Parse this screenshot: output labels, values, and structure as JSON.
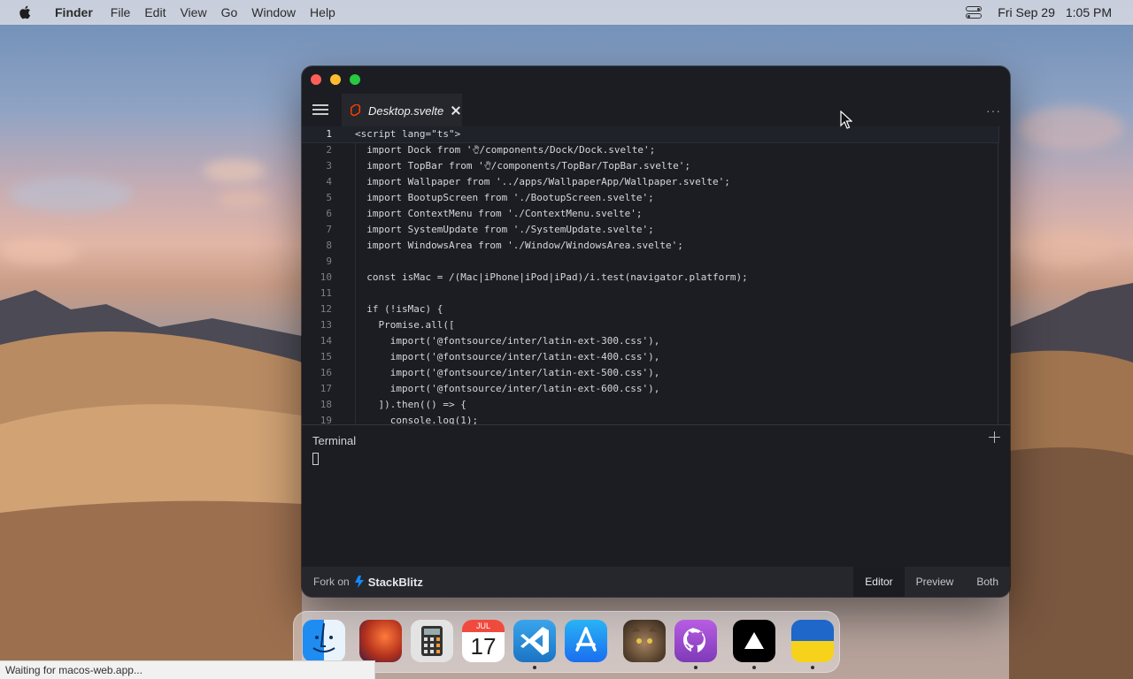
{
  "menubar": {
    "apple_icon": "apple-logo-icon",
    "app_name": "Finder",
    "items": [
      "File",
      "Edit",
      "View",
      "Go",
      "Window",
      "Help"
    ],
    "control_center_icon": "control-center-icon",
    "date": "Fri Sep 29",
    "time": "1:05 PM"
  },
  "window": {
    "tab": {
      "icon": "svelte-icon",
      "label": "Desktop.svelte"
    },
    "more_icon": "more-icon",
    "editor": {
      "current_line": 1,
      "lines": [
        {
          "num": "1",
          "text": "<script lang=\"ts\">"
        },
        {
          "num": "2",
          "text": "  import Dock from '🖐︎/components/Dock/Dock.svelte';"
        },
        {
          "num": "3",
          "text": "  import TopBar from '🖐︎/components/TopBar/TopBar.svelte';"
        },
        {
          "num": "4",
          "text": "  import Wallpaper from '../apps/WallpaperApp/Wallpaper.svelte';"
        },
        {
          "num": "5",
          "text": "  import BootupScreen from './BootupScreen.svelte';"
        },
        {
          "num": "6",
          "text": "  import ContextMenu from './ContextMenu.svelte';"
        },
        {
          "num": "7",
          "text": "  import SystemUpdate from './SystemUpdate.svelte';"
        },
        {
          "num": "8",
          "text": "  import WindowsArea from './Window/WindowsArea.svelte';"
        },
        {
          "num": "9",
          "text": ""
        },
        {
          "num": "10",
          "text": "  const isMac = /(Mac|iPhone|iPod|iPad)/i.test(navigator.platform);"
        },
        {
          "num": "11",
          "text": ""
        },
        {
          "num": "12",
          "text": "  if (!isMac) {"
        },
        {
          "num": "13",
          "text": "    Promise.all(["
        },
        {
          "num": "14",
          "text": "      import('@fontsource/inter/latin-ext-300.css'),"
        },
        {
          "num": "15",
          "text": "      import('@fontsource/inter/latin-ext-400.css'),"
        },
        {
          "num": "16",
          "text": "      import('@fontsource/inter/latin-ext-500.css'),"
        },
        {
          "num": "17",
          "text": "      import('@fontsource/inter/latin-ext-600.css'),"
        },
        {
          "num": "18",
          "text": "    ]).then(() => {"
        },
        {
          "num": "19",
          "text": "      console.log(1);"
        }
      ]
    },
    "terminal": {
      "title": "Terminal",
      "add_icon": "plus-icon"
    },
    "footer": {
      "fork_text": "Fork on",
      "brand_icon": "bolt-icon",
      "brand": "StackBlitz",
      "views": [
        "Editor",
        "Preview",
        "Both"
      ],
      "active_view": "Editor"
    }
  },
  "dock": {
    "apps": [
      {
        "name": "Finder",
        "icon": "finder-icon",
        "running": false
      },
      {
        "name": "Wallpapers",
        "icon": "wallpapers-icon",
        "running": false
      },
      {
        "name": "Calculator",
        "icon": "calculator-icon",
        "running": false
      },
      {
        "name": "Calendar",
        "icon": "calendar-icon",
        "month": "JUL",
        "day": "17",
        "running": false
      },
      {
        "name": "VS Code",
        "icon": "vscode-icon",
        "running": true
      },
      {
        "name": "App Store",
        "icon": "app-store-icon",
        "running": false
      },
      {
        "name": "Purrfect",
        "icon": "cat-icon",
        "running": false
      },
      {
        "name": "GitHub",
        "icon": "github-icon",
        "running": true
      },
      {
        "name": "Vercel",
        "icon": "vercel-icon",
        "running": true
      },
      {
        "name": "Ukraine",
        "icon": "ukraine-flag-icon",
        "running": true
      }
    ]
  },
  "status": {
    "text": "Waiting for macos-web.app..."
  },
  "colors": {
    "accent_svelte": "#ff3e00",
    "accent_stackblitz": "#1389fd"
  }
}
